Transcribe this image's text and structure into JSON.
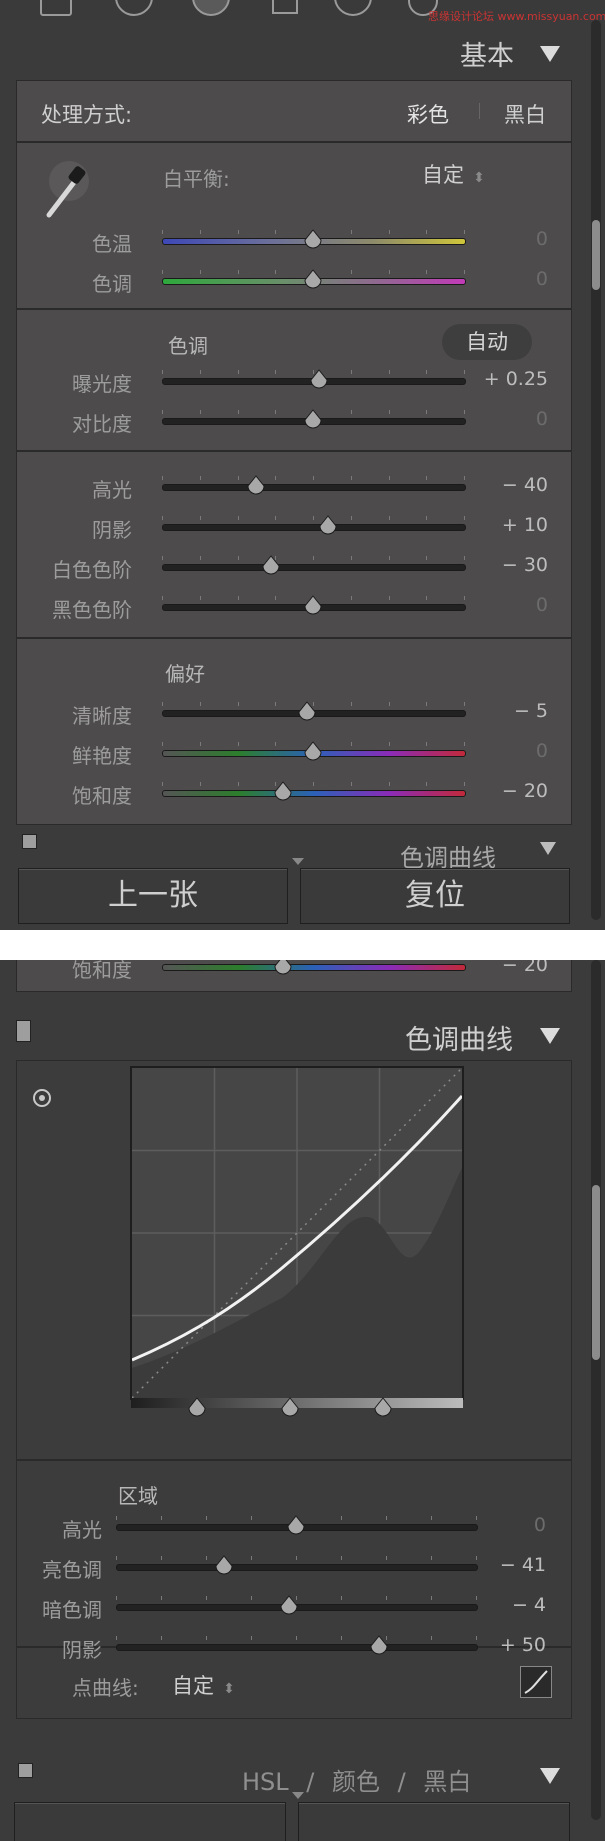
{
  "panel1": {
    "header_title": "基本",
    "watermark": "思缘设计论坛 www.missyuan.com",
    "treatment": {
      "label": "处理方式:",
      "color": "彩色",
      "bw": "黑白"
    },
    "white_balance": {
      "label": "白平衡:",
      "value": "自定",
      "arrow": "⬍"
    },
    "wb_sliders": [
      {
        "label": "色温",
        "value": "0",
        "position": 0.5
      },
      {
        "label": "色调",
        "value": "0",
        "position": 0.5
      }
    ],
    "tone": {
      "label": "色调",
      "auto_button": "自动"
    },
    "tone_sliders": [
      {
        "label": "曝光度",
        "value": "+ 0.25",
        "position": 0.52
      },
      {
        "label": "对比度",
        "value": "0",
        "position": 0.5
      }
    ],
    "light_sliders": [
      {
        "label": "高光",
        "value": "− 40",
        "position": 0.31
      },
      {
        "label": "阴影",
        "value": "+ 10",
        "position": 0.55
      },
      {
        "label": "白色色阶",
        "value": "− 30",
        "position": 0.36
      },
      {
        "label": "黑色色阶",
        "value": "0",
        "position": 0.5
      }
    ],
    "presence": {
      "label": "偏好"
    },
    "presence_sliders": [
      {
        "label": "清晰度",
        "value": "− 5",
        "position": 0.48
      },
      {
        "label": "鲜艳度",
        "value": "0",
        "position": 0.5
      },
      {
        "label": "饱和度",
        "value": "− 20",
        "position": 0.4
      }
    ],
    "next_section": "色调曲线",
    "prev_button": "上一张",
    "reset_button": "复位"
  },
  "panel2": {
    "top_slider": {
      "label": "饱和度",
      "value": "− 20",
      "position": 0.4
    },
    "header_title": "色调曲线",
    "region_label": "区域",
    "region_sliders": [
      {
        "label": "高光",
        "value": "0",
        "position": 0.5
      },
      {
        "label": "亮色调",
        "value": "− 41",
        "position": 0.3
      },
      {
        "label": "暗色调",
        "value": "− 4",
        "position": 0.48
      },
      {
        "label": "阴影",
        "value": "+ 50",
        "position": 0.73
      }
    ],
    "point_curve": {
      "label": "点曲线:",
      "value": "自定",
      "arrow": "⬍"
    },
    "next_section": {
      "hsl": "HSL",
      "sep": "/",
      "color": "颜色",
      "bw": "黑白"
    },
    "split_positions": [
      0.2,
      0.48,
      0.76
    ]
  },
  "colors": {
    "panel_bg": "#3b3b3b",
    "inset_bg": "#4d4b4b",
    "label": "#9c9c9c",
    "value": "#bdbdbd",
    "thumb": "#a8a8a8",
    "curve": "#f2f2f2"
  }
}
